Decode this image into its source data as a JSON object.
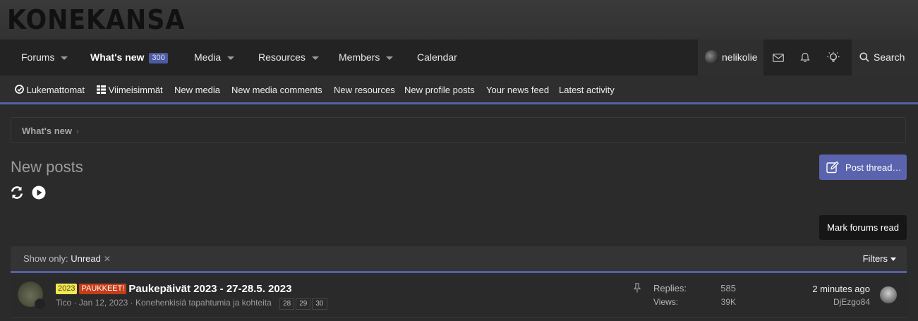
{
  "site": {
    "logo": "KONEKANSA"
  },
  "nav": {
    "items": [
      {
        "label": "Forums"
      },
      {
        "label": "What's new",
        "badge": "300"
      },
      {
        "label": "Media"
      },
      {
        "label": "Resources"
      },
      {
        "label": "Members"
      },
      {
        "label": "Calendar"
      }
    ],
    "user": "nelikolie",
    "search_label": "Search"
  },
  "subnav": {
    "items": [
      {
        "label": "Lukemattomat"
      },
      {
        "label": "Viimeisimmät"
      },
      {
        "label": "New media"
      },
      {
        "label": "New media comments"
      },
      {
        "label": "New resources"
      },
      {
        "label": "New profile posts"
      },
      {
        "label": "Your news feed"
      },
      {
        "label": "Latest activity"
      }
    ]
  },
  "breadcrumb": {
    "item": "What's new"
  },
  "page": {
    "title": "New posts",
    "post_thread_label": "Post thread…",
    "mark_read_label": "Mark forums read"
  },
  "filter": {
    "show_only_label": "Show only:",
    "show_only_value": "Unread",
    "filters_label": "Filters"
  },
  "threads": [
    {
      "prefix_year": "2023",
      "prefix_tag": "PAUKKEET!",
      "title": "Paukepäivät 2023 - 27-28.5. 2023",
      "author": "Tico",
      "date": "Jan 12, 2023",
      "forum": "Konehenkisiä tapahtumia ja kohteita",
      "pages": [
        "28",
        "29",
        "30"
      ],
      "replies_label": "Replies:",
      "replies": "585",
      "views_label": "Views:",
      "views": "39K",
      "last_time": "2 minutes ago",
      "last_user": "DjEzgo84"
    }
  ],
  "colors": {
    "accent": "#5560a8",
    "button": "#5a63ad",
    "prefix_yellow": "#f4e94a",
    "prefix_red": "#c43d18"
  }
}
